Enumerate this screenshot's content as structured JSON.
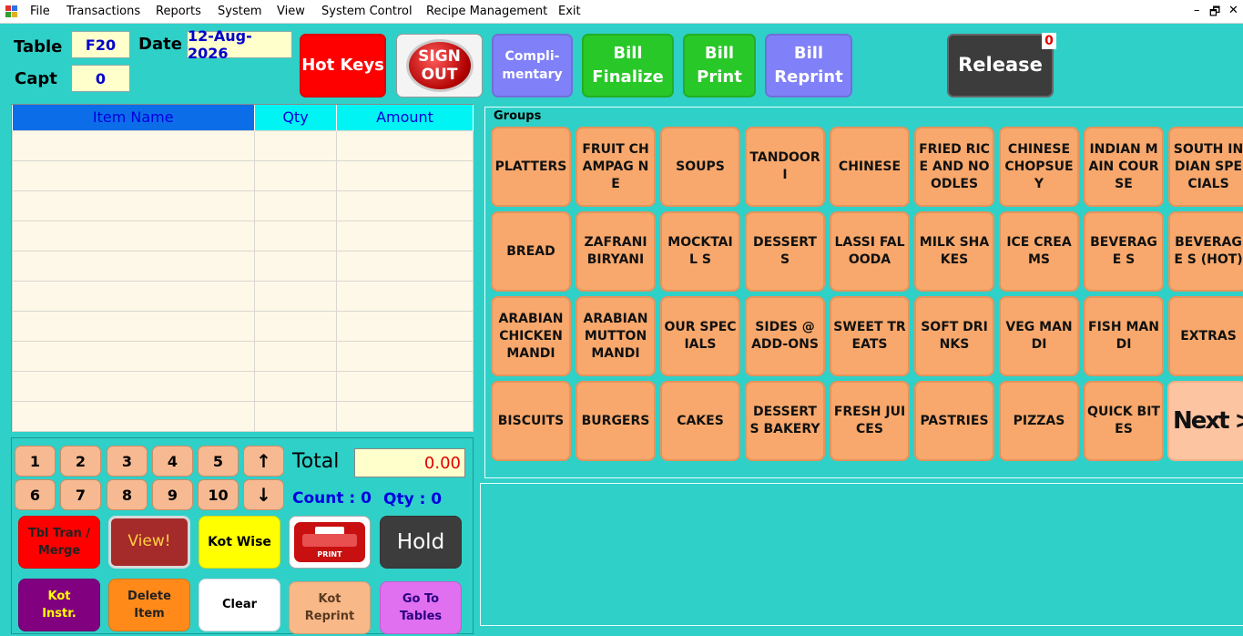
{
  "menubar": {
    "items": [
      "File",
      "Transactions",
      "Reports",
      "System",
      "View",
      "System Control",
      "Recipe Management",
      "Exit"
    ],
    "minimize": "–",
    "restore": "🗗",
    "close": "✕"
  },
  "header": {
    "table_label": "Table",
    "table_value": "F20",
    "date_label": "Date",
    "date_value": "12-Aug-2026",
    "capt_label": "Capt",
    "capt_value": "0"
  },
  "toolbar": {
    "hot_keys": "Hot Keys",
    "sign_out_line1": "SIGN",
    "sign_out_line2": "OUT",
    "complimentary_line1": "Compli-",
    "complimentary_line2": "mentary",
    "bill_finalize_line1": "Bill",
    "bill_finalize_line2": "Finalize",
    "bill_print_line1": "Bill",
    "bill_print_line2": "Print",
    "bill_reprint_line1": "Bill",
    "bill_reprint_line2": "Reprint",
    "release": "Release",
    "release_badge": "0"
  },
  "items_grid": {
    "columns": [
      "Item Name",
      "Qty",
      "Amount"
    ],
    "row_count": 10
  },
  "keypad": {
    "keys": [
      "1",
      "2",
      "3",
      "4",
      "5",
      "↑",
      "6",
      "7",
      "8",
      "9",
      "10",
      "↓"
    ],
    "total_label": "Total",
    "total_value": "0.00",
    "count_label": "Count : 0",
    "qty_label": "Qty : 0"
  },
  "actions": {
    "tbl_tran_line1": "Tbl Tran /",
    "tbl_tran_line2": "Merge",
    "view": "View!",
    "kot_wise": "Kot Wise",
    "print": "PRINT",
    "hold": "Hold",
    "kot_instr_line1": "Kot",
    "kot_instr_line2": "Instr.",
    "delete_item_line1": "Delete",
    "delete_item_line2": "Item",
    "clear": "Clear",
    "kot_reprint_line1": "Kot",
    "kot_reprint_line2": "Reprint",
    "go_to_tables_line1": "Go To",
    "go_to_tables_line2": "Tables"
  },
  "groups": {
    "legend": "Groups",
    "items": [
      "PLATTERS",
      "FRUIT CHAMPAG NE",
      "SOUPS",
      "TANDOORI",
      "CHINESE",
      "FRIED RICE AND NOODLES",
      "CHINESE CHOPSUEY",
      "INDIAN MAIN COURSE",
      "SOUTH INDIAN SPECIALS",
      "BREAD",
      "ZAFRANI BIRYANI",
      "MOCKTAIL S",
      "DESSERTS",
      "LASSI FALOODA",
      "MILK SHAKES",
      "ICE CREAMS",
      "BEVERAGE S",
      "BEVERAGE S (HOT)",
      "ARABIAN CHICKEN MANDI",
      "ARABIAN MUTTON MANDI",
      "OUR SPECIALS",
      "SIDES @ ADD-ONS",
      "SWEET TREATS",
      "SOFT DRINKS",
      "VEG MANDI",
      "FISH MANDI",
      "EXTRAS",
      "BISCUITS",
      "BURGERS",
      "CAKES",
      "DESSERTS BAKERY",
      "FRESH JUICES",
      "PASTRIES",
      "PIZZAS",
      "QUICK BITES"
    ],
    "next": "Next >>"
  },
  "colors": {
    "background": "#2fd0c8",
    "group_button": "#f8a86c",
    "hot_keys": "#ff0000",
    "complimentary": "#8080f8",
    "bill_green": "#28c828",
    "release": "#3c3c3c"
  }
}
